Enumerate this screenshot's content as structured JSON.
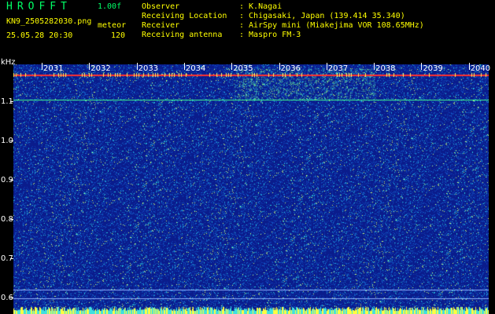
{
  "header": {
    "program": "HROFFT",
    "version": "1.00f",
    "filename": "KN9_2505282030.png",
    "timestamp": "25.05.28 20:30",
    "mode": "meteor",
    "gain": "120"
  },
  "info": [
    {
      "key": "Observer",
      "value": ": K.Nagai"
    },
    {
      "key": "Receiving Location",
      "value": ": Chigasaki, Japan (139.414 35.340)"
    },
    {
      "key": "Receiver",
      "value": ": AirSpy mini (Miakejima VOR 108.65MHz)"
    },
    {
      "key": "Receiving antenna",
      "value": ": Maspro FM-3"
    }
  ],
  "axis": {
    "unit": "kHz",
    "y_labels": [
      "1.1",
      "1.0",
      "0.9",
      "0.8",
      "0.7",
      "0.6"
    ],
    "minute_labels": [
      "2031",
      "2032",
      "2033",
      "2034",
      "2035",
      "2036",
      "2037",
      "2038",
      "2039",
      "2040"
    ]
  },
  "colors": {
    "background": "#0a1c8c",
    "signal_line": "#ff3030",
    "label": "#ffff00"
  }
}
